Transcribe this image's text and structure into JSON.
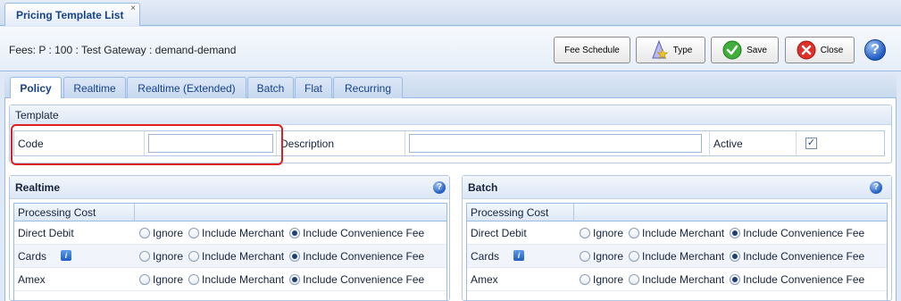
{
  "top_tab": {
    "label": "Pricing Template List",
    "close": "×"
  },
  "toolbar": {
    "fees_text": "Fees: P : 100 : Test Gateway : demand-demand",
    "fee_schedule": "Fee Schedule",
    "type": "Type",
    "save": "Save",
    "close": "Close",
    "help": "?"
  },
  "tabs": [
    "Policy",
    "Realtime",
    "Realtime (Extended)",
    "Batch",
    "Flat",
    "Recurring"
  ],
  "template": {
    "title": "Template",
    "code_label": "Code",
    "code_value": "",
    "description_label": "Description",
    "description_value": "",
    "active_label": "Active",
    "active_checked": true
  },
  "realtime": {
    "title": "Realtime",
    "header": "Processing Cost",
    "rows": [
      {
        "label": "Direct Debit",
        "selected": "Include Convenience Fee"
      },
      {
        "label": "Cards",
        "selected": "Include Convenience Fee",
        "info": true
      },
      {
        "label": "Amex",
        "selected": "Include Convenience Fee"
      }
    ]
  },
  "batch": {
    "title": "Batch",
    "header": "Processing Cost",
    "rows": [
      {
        "label": "Direct Debit",
        "selected": "Include Convenience Fee"
      },
      {
        "label": "Cards",
        "selected": "Include Convenience Fee",
        "info": true
      },
      {
        "label": "Amex",
        "selected": "Include Convenience Fee"
      }
    ]
  },
  "radio_options": [
    "Ignore",
    "Include Merchant",
    "Include Convenience Fee"
  ],
  "colors": {
    "accent": "#15428b",
    "border": "#99bbe8",
    "highlight": "#e02020"
  }
}
